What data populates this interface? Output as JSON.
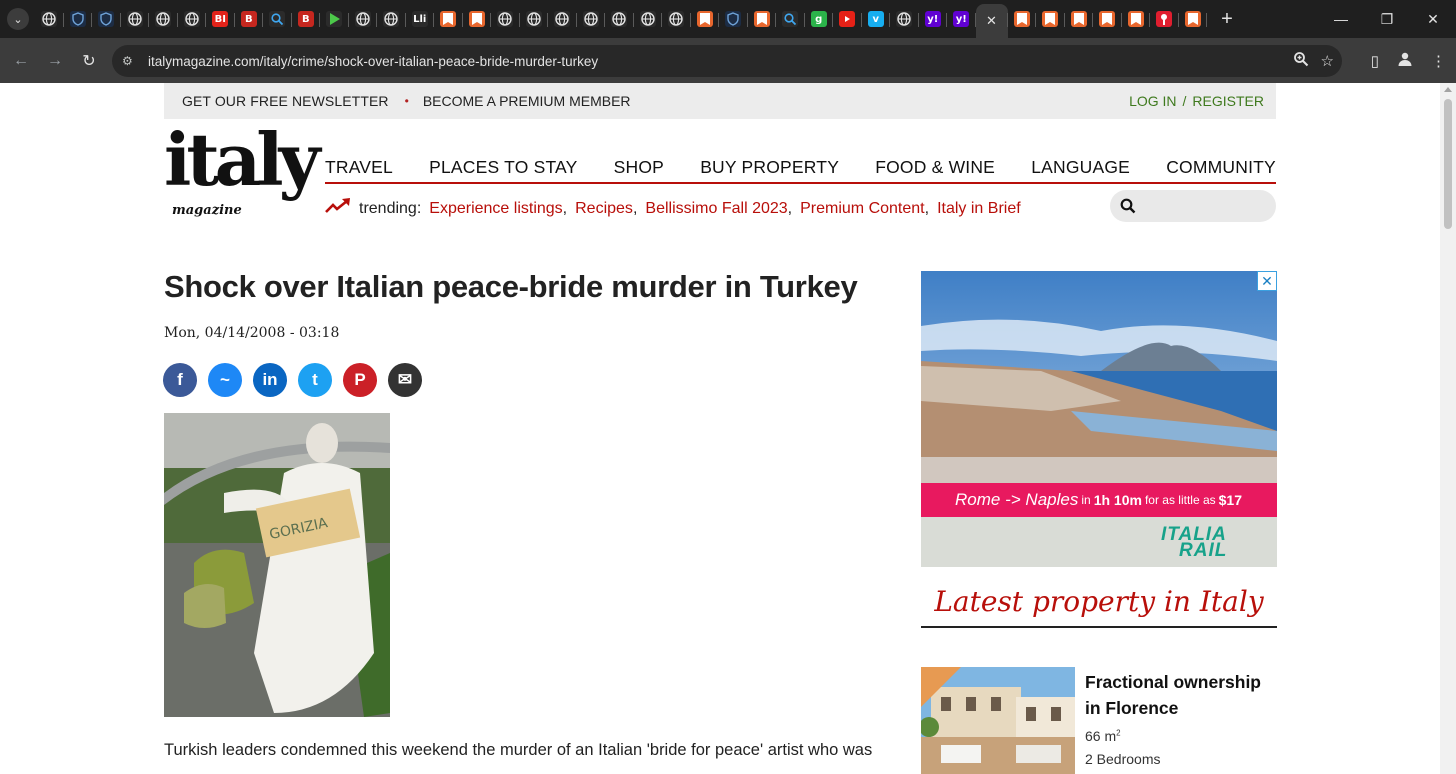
{
  "browser": {
    "url": "italymagazine.com/italy/crime/shock-over-italian-peace-bride-murder-turkey",
    "tabs": [
      {
        "icon": "globe",
        "color": "#2b2b2b"
      },
      {
        "icon": "shield",
        "color": "#1c2c44"
      },
      {
        "icon": "shield",
        "color": "#1c2c44"
      },
      {
        "icon": "globe",
        "color": "#2b2b2b"
      },
      {
        "icon": "globe",
        "color": "#2b2b2b"
      },
      {
        "icon": "globe",
        "color": "#2b2b2b"
      },
      {
        "icon": "letters",
        "text": "BI",
        "color": "#e2231a"
      },
      {
        "icon": "letters",
        "text": "B",
        "color": "#c6271f"
      },
      {
        "icon": "search",
        "color": "#2b2b2b"
      },
      {
        "icon": "letters",
        "text": "B",
        "color": "#c6271f"
      },
      {
        "icon": "play",
        "color": "#2b2b2b"
      },
      {
        "icon": "globe",
        "color": "#2b2b2b"
      },
      {
        "icon": "globe",
        "color": "#2b2b2b"
      },
      {
        "icon": "letters",
        "text": "Lli",
        "color": "#2b2b2b"
      },
      {
        "icon": "bookmark",
        "color": "#e8672e"
      },
      {
        "icon": "bookmark",
        "color": "#e8672e"
      },
      {
        "icon": "globe",
        "color": "#2b2b2b"
      },
      {
        "icon": "globe",
        "color": "#2b2b2b"
      },
      {
        "icon": "globe",
        "color": "#2b2b2b"
      },
      {
        "icon": "globe",
        "color": "#2b2b2b"
      },
      {
        "icon": "globe",
        "color": "#2b2b2b"
      },
      {
        "icon": "globe",
        "color": "#2b2b2b"
      },
      {
        "icon": "globe",
        "color": "#2b2b2b"
      },
      {
        "icon": "bookmark",
        "color": "#e8672e"
      },
      {
        "icon": "shield",
        "color": "#1c2c44"
      },
      {
        "icon": "bookmark",
        "color": "#e8672e"
      },
      {
        "icon": "search",
        "color": "#2b2b2b"
      },
      {
        "icon": "letters",
        "text": "g",
        "color": "#2bb34a"
      },
      {
        "icon": "youtube",
        "color": "#e62117"
      },
      {
        "icon": "letters",
        "text": "v",
        "color": "#17aef0"
      },
      {
        "icon": "globe",
        "color": "#2b2b2b"
      },
      {
        "icon": "letters",
        "text": "y!",
        "color": "#6001d2"
      },
      {
        "icon": "letters",
        "text": "y!",
        "color": "#6001d2"
      },
      {
        "icon": "close",
        "color": "#3c3c3c",
        "active": true
      },
      {
        "icon": "bookmark",
        "color": "#e8672e"
      },
      {
        "icon": "bookmark",
        "color": "#e8672e"
      },
      {
        "icon": "bookmark",
        "color": "#e8672e"
      },
      {
        "icon": "bookmark",
        "color": "#e8672e"
      },
      {
        "icon": "bookmark",
        "color": "#e8672e"
      },
      {
        "icon": "pin",
        "color": "#e01e2f"
      },
      {
        "icon": "bookmark",
        "color": "#e8672e"
      }
    ]
  },
  "topbar": {
    "newsletter": "GET OUR FREE NEWSLETTER",
    "premium": "BECOME A PREMIUM MEMBER",
    "login": "LOG IN",
    "slash": "/",
    "register": "REGISTER"
  },
  "logo": {
    "main": "italy",
    "sub": "magazine"
  },
  "nav": [
    "TRAVEL",
    "PLACES TO STAY",
    "SHOP",
    "BUY PROPERTY",
    "FOOD & WINE",
    "LANGUAGE",
    "COMMUNITY"
  ],
  "trending": {
    "label": "trending:",
    "links": [
      "Experience listings",
      "Recipes",
      "Bellissimo Fall 2023",
      "Premium Content",
      "Italy in Brief"
    ]
  },
  "article": {
    "title": "Shock over Italian peace-bride murder in Turkey",
    "date": "Mon, 04/14/2008 - 03:18",
    "sign_text": "GORIZIA",
    "body": "Turkish leaders condemned this weekend the murder of an Italian 'bride for peace' artist who was"
  },
  "share": [
    {
      "name": "facebook-icon",
      "glyph": "f",
      "color": "#3b5998"
    },
    {
      "name": "messenger-icon",
      "glyph": "~",
      "color": "#1e88f6"
    },
    {
      "name": "linkedin-icon",
      "glyph": "in",
      "color": "#0a66c2"
    },
    {
      "name": "twitter-icon",
      "glyph": "t",
      "color": "#1da1f2"
    },
    {
      "name": "pinterest-icon",
      "glyph": "P",
      "color": "#cb2027"
    },
    {
      "name": "email-icon",
      "glyph": "✉",
      "color": "#333333"
    }
  ],
  "ad": {
    "from": "Rome",
    "arrow": "->",
    "to": "Naples",
    "in": "in",
    "duration": "1h 10m",
    "for_as_little_as": "for as little as",
    "price": "$17",
    "brand_line1": "ITALIA",
    "brand_line2": "RAIL",
    "close": "✕"
  },
  "property": {
    "section_title": "Latest property in Italy",
    "title": "Fractional ownership in Florence",
    "area": "66 m",
    "area_sup": "2",
    "bedrooms": "2 Bedrooms"
  }
}
